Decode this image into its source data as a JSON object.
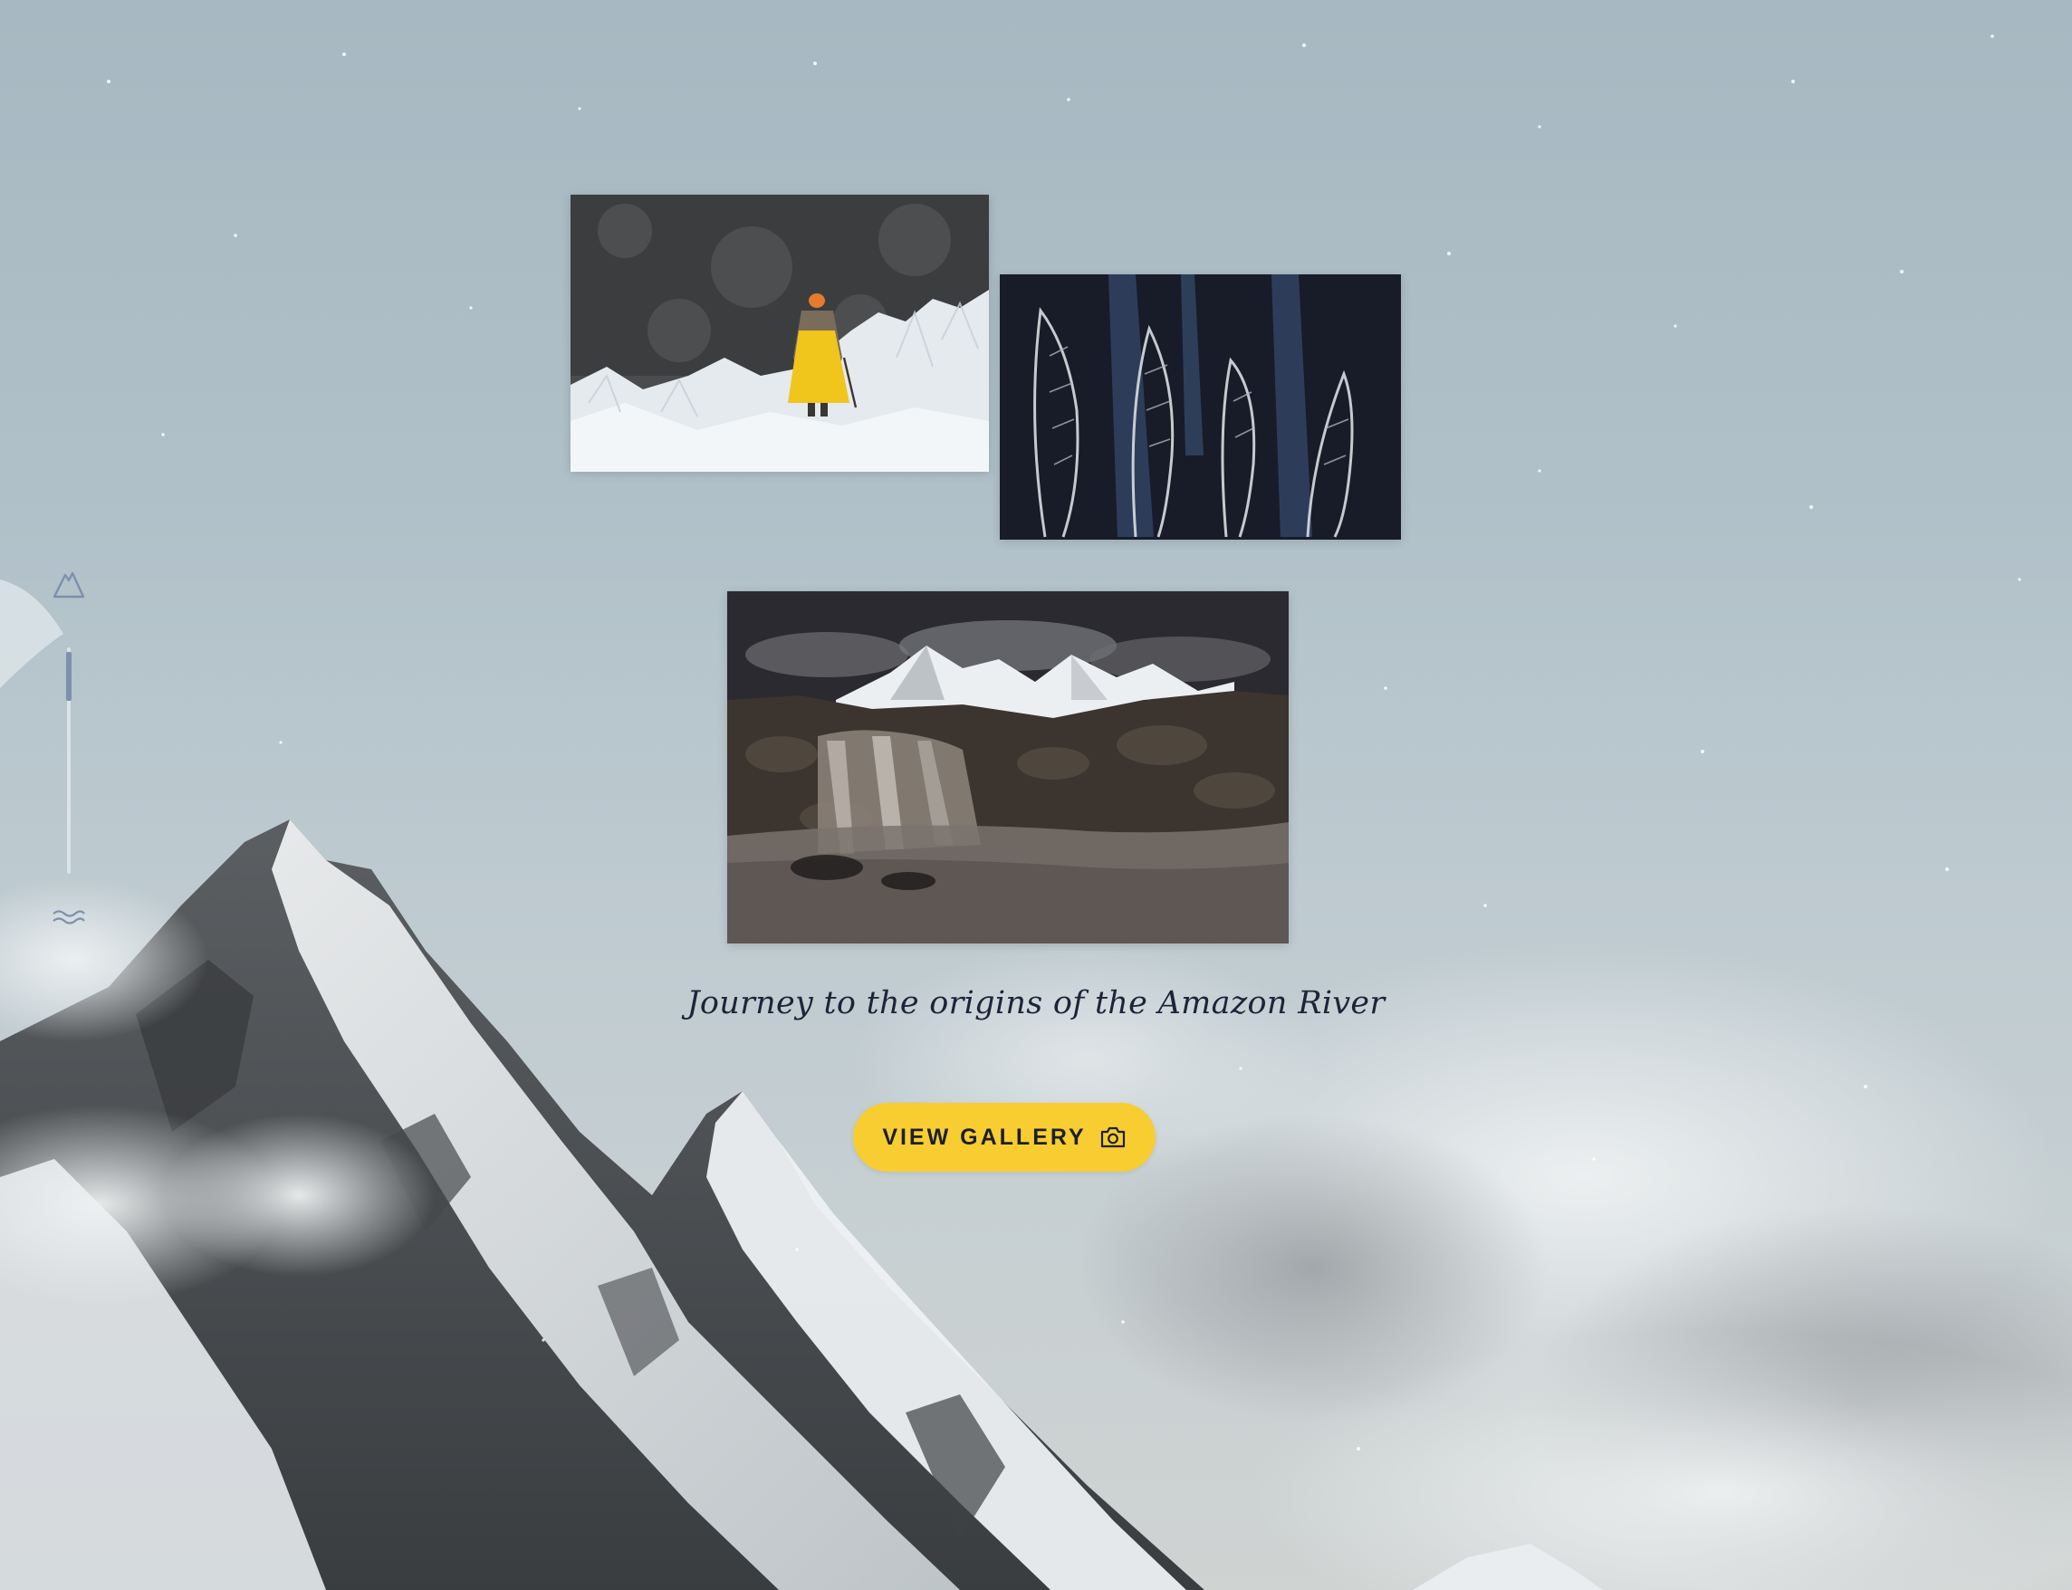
{
  "story": {
    "caption": "Journey to the origins of the Amazon River",
    "button_label": "VIEW GALLERY",
    "button_icon": "camera-icon"
  },
  "scrubber": {
    "top_icon": "mountain-icon",
    "bottom_icon": "water-waves-icon",
    "progress": 0.2
  },
  "photos": [
    {
      "subject": "hiker-in-yellow-on-glacier"
    },
    {
      "subject": "frozen-ice-feathers"
    },
    {
      "subject": "night-waterfall-under-snowy-peaks"
    }
  ],
  "colors": {
    "sky": "#a9bac4",
    "button": "#f7cd31",
    "caption_text": "#1e2438",
    "scrubber_thumb": "#7d90ad"
  }
}
